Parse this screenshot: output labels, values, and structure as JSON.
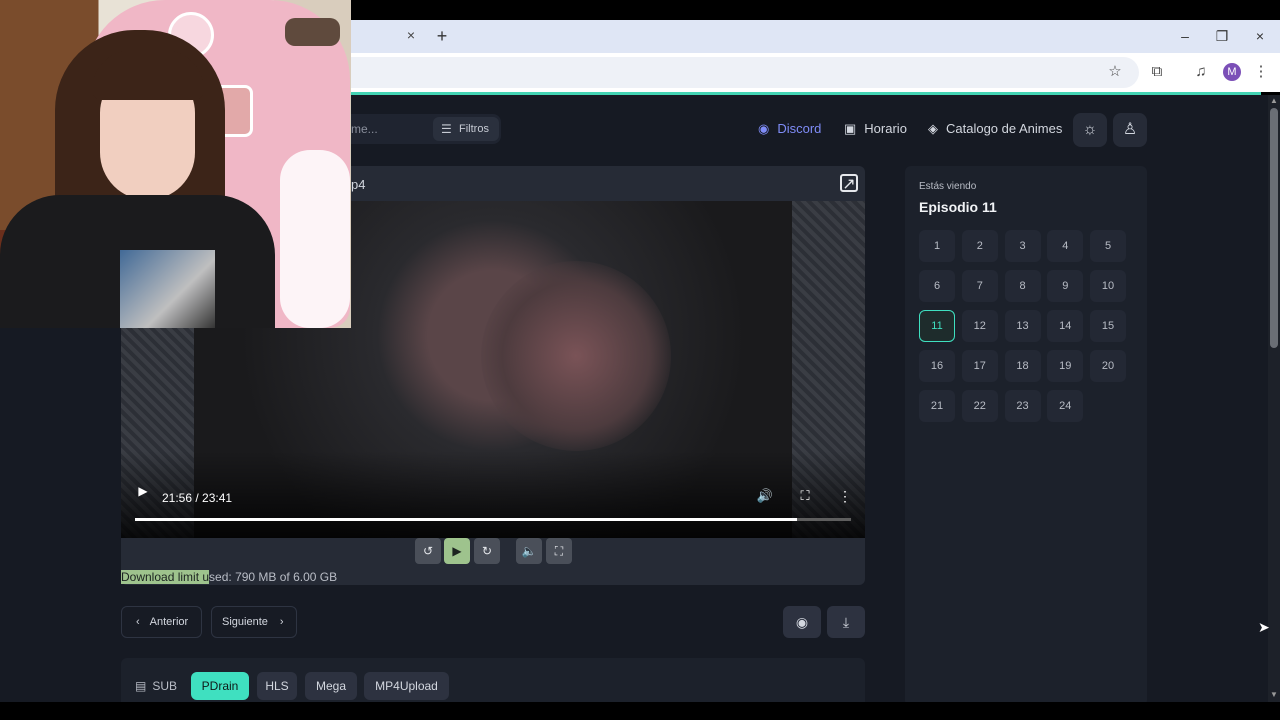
{
  "browser": {
    "tab_close": "×",
    "new_tab": "+",
    "window": {
      "minimize": "–",
      "restore": "❐",
      "close": "×"
    },
    "profile_initial": "M"
  },
  "header": {
    "search_placeholder": "me...",
    "filters_label": "Filtros",
    "nav": {
      "discord": "Discord",
      "horario": "Horario",
      "catalogo": "Catalogo de Animes"
    }
  },
  "player": {
    "title_fragment": "p4",
    "current_time": "21:56 / 23:41",
    "progress_fraction": 0.925,
    "download_highlight": "Download limit u",
    "download_rest": "sed: 790 MB of 6.00 GB"
  },
  "navigation": {
    "prev_label": "Anterior",
    "next_label": "Siguiente"
  },
  "servers": {
    "sub_label": "SUB",
    "items": [
      "PDrain",
      "HLS",
      "Mega",
      "MP4Upload"
    ],
    "active_index": 0
  },
  "episodes": {
    "watching_label": "Estás viendo",
    "current_label": "Episodio 11",
    "list": [
      "1",
      "2",
      "3",
      "4",
      "5",
      "6",
      "7",
      "8",
      "9",
      "10",
      "11",
      "12",
      "13",
      "14",
      "15",
      "16",
      "17",
      "18",
      "19",
      "20",
      "21",
      "22",
      "23",
      "24"
    ],
    "active": "11"
  },
  "colors": {
    "accent": "#3fe0c0",
    "discord": "#7f8cf7",
    "highlight": "#9ec38d",
    "page_bg": "#161a23"
  }
}
